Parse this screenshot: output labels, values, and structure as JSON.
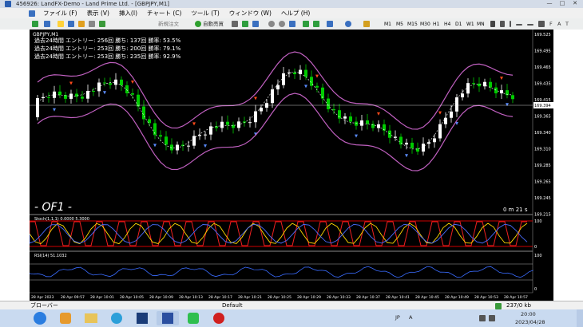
{
  "window": {
    "title": "456926: LandFX-Demo - Land Prime Ltd. - [GBPJPY,M1]",
    "controls": [
      "—",
      "□",
      "✕"
    ]
  },
  "menu": [
    "ファイル (F)",
    "表示 (V)",
    "挿入(I)",
    "チャート (C)",
    "ツール (T)",
    "ウィンドウ (W)",
    "ヘルプ (H)"
  ],
  "toolbar": {
    "new_order": "新規注文",
    "auto_trading": "自動売買",
    "timeframes": [
      "M1",
      "M5",
      "M15",
      "M30",
      "H1",
      "H4",
      "D1",
      "W1",
      "MN"
    ]
  },
  "chart": {
    "symbol_label": "GBPJPY,M1",
    "stats": [
      "過去24時間  エントリー: 256回   勝ち: 137回   勝率: 53.5%",
      "過去24時間  エントリー: 253回   勝ち: 200回   勝率: 79.1%",
      "過去24時間  エントリー: 253回   勝ち: 235回   勝率: 92.9%"
    ],
    "watermark": "- OF1 -",
    "countdown": "0 m 21 s",
    "current_price": "169.394",
    "price_ticks": [
      "169.525",
      "169.495",
      "169.465",
      "169.435",
      "169.415",
      "169.365",
      "169.340",
      "169.310",
      "169.285",
      "169.265",
      "169.245",
      "169.215"
    ],
    "time_ticks": [
      "28 Apr 2023",
      "28 Apr 09:57",
      "28 Apr 10:01",
      "28 Apr 10:05",
      "28 Apr 10:09",
      "28 Apr 10:13",
      "28 Apr 10:17",
      "28 Apr 10:21",
      "28 Apr 10:25",
      "28 Apr 10:29",
      "28 Apr 10:33",
      "28 Apr 10:37",
      "28 Apr 10:41",
      "28 Apr 10:45",
      "28 Apr 10:49",
      "28 Apr 10:53",
      "28 Apr 10:57"
    ],
    "stoch_label": "Stoch(1,1,1) 0.0000 5.3000",
    "stoch_ticks": [
      "100",
      "0"
    ],
    "rsi_label": "RSI(14) 51.1032",
    "rsi_ticks": [
      "100",
      "0"
    ],
    "colors": {
      "bg": "#000000",
      "bull": "#ffffff",
      "bear": "#00cc00",
      "band": "#c060c0",
      "up_arrow": "#5a8cff",
      "down_arrow": "#ff4a1a"
    }
  },
  "status": {
    "tab_label": "ブローバー",
    "profile": "Default",
    "traffic": "237/0 kb"
  },
  "taskbar": {
    "time": "20:00",
    "date": "2023/04/28",
    "lang": "JP",
    "ime": "A"
  }
}
